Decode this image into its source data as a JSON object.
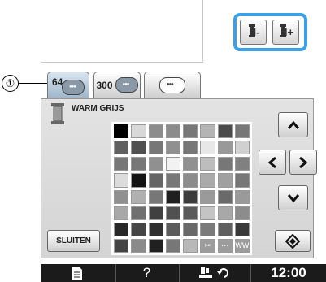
{
  "header": {
    "thread_minus_label": "I-",
    "thread_plus_label": "I+"
  },
  "tabs": [
    {
      "label": "64",
      "active": true
    },
    {
      "label": "300",
      "active": false
    },
    {
      "label": "",
      "active": false
    }
  ],
  "callout": "①",
  "color_name": "WARM GRIJS",
  "palette": [
    "#000000",
    "#d8d8d8",
    "#8c8c8c",
    "#8c8c8c",
    "#777777",
    "#b4b4b4",
    "#4a4a4a",
    "#777777",
    "#606060",
    "#505050",
    "#777777",
    "#909090",
    "#777777",
    "#e8e8e8",
    "#999999",
    "#d0d0d0",
    "#777777",
    "#777777",
    "#909090",
    "#f2f2f2",
    "#909090",
    "#bdbdbd",
    "#777777",
    "#808080",
    "#dcdcdc",
    "#141414",
    "#666666",
    "#777777",
    "#8c8c8c",
    "#aaaaaa",
    "#a0a0a0",
    "#777777",
    "#909090",
    "#b0b0b0",
    "#777777",
    "#202020",
    "#3c3c3c",
    "#9a9a9a",
    "#6a6a6a",
    "#9a9a9a",
    "#a8a8a8",
    "#707070",
    "#404040",
    "#505050",
    "#5a5a5a",
    "#c4c4c4",
    "#a8a8a8",
    "#8c8c8c",
    "#282828",
    "#454545",
    "#303030",
    "#5c5c5c",
    "#686868",
    "#7a7a7a",
    "#606060",
    "#383838",
    "#444444",
    "#8a8a8a",
    "#202020",
    "#777777",
    "#b8b8b8",
    "#9c9c9c",
    "#9c9c9c",
    "#9c9c9c"
  ],
  "selected_index": 0,
  "special_cells": {
    "61": "✂",
    "62": "···",
    "63": "WW"
  },
  "buttons": {
    "close_label": "SLUITEN"
  },
  "bottom_bar": {
    "help_label": "?",
    "time": "12:00"
  },
  "colors": {
    "highlight": "#3aa0e8",
    "bottom_bar": "#1b1b1b"
  }
}
